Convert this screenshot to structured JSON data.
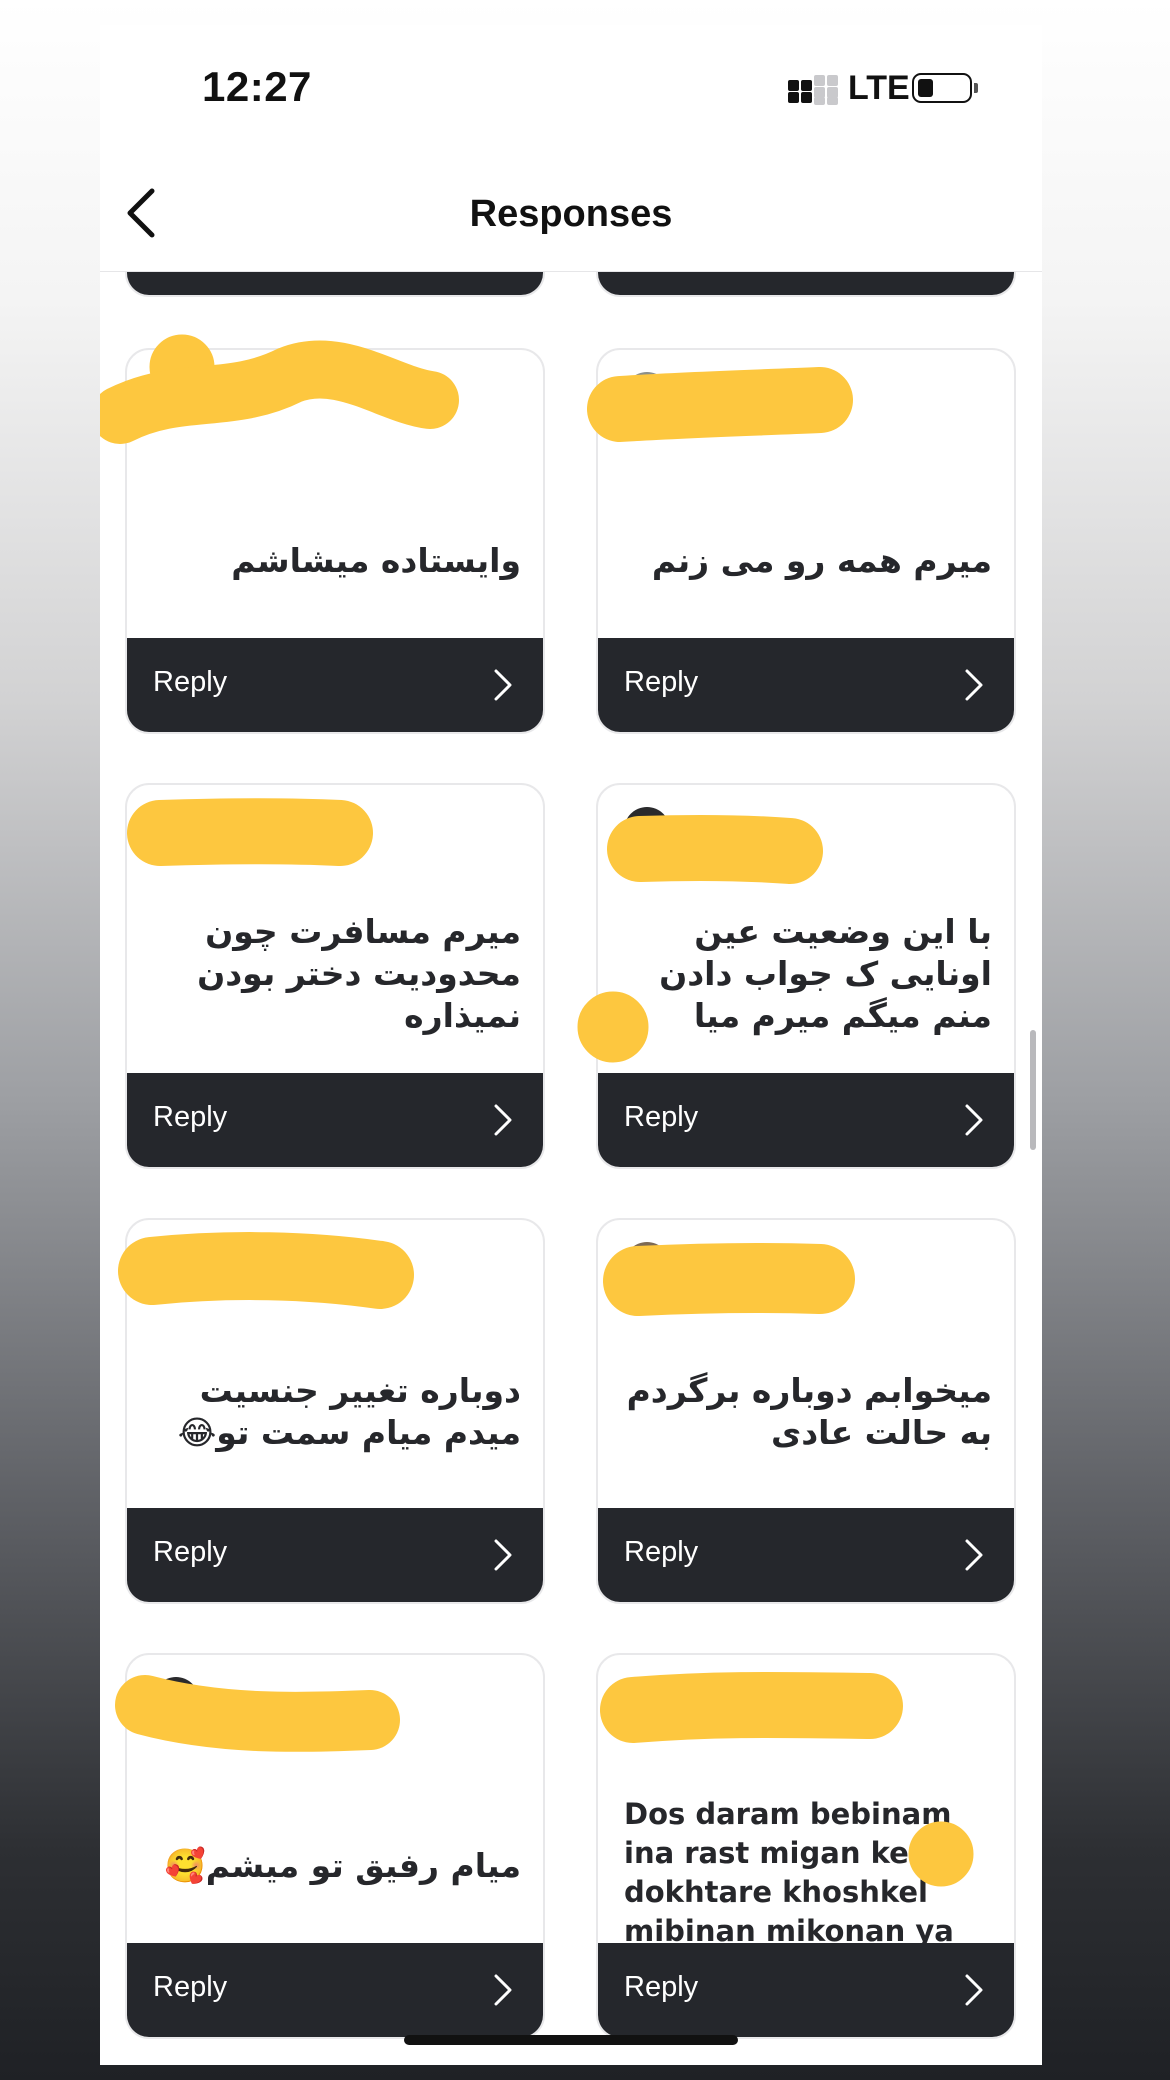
{
  "status": {
    "time": "12:27",
    "network": "LTE"
  },
  "header": {
    "title": "Responses",
    "back_icon": "chevron-left-icon"
  },
  "reply_label": "Reply",
  "cards": [
    {
      "text": "",
      "dir": "rtl"
    },
    {
      "text": "",
      "dir": "rtl"
    },
    {
      "text": "وایستاده میشاشم",
      "dir": "rtl"
    },
    {
      "text": "میرم  همه رو می زنم",
      "dir": "rtl"
    },
    {
      "text": "میرم مسافرت چون محدودیت دختر بودن نمیذاره",
      "dir": "rtl"
    },
    {
      "text": "با این وضعیت عین اونایی ک جواب دادن منم میگم میرم میا",
      "dir": "rtl"
    },
    {
      "text": "دوباره تغییر جنسیت میدم میام سمت تو😂",
      "dir": "rtl"
    },
    {
      "text": "میخوابم دوباره برگردم به حالت عادی",
      "dir": "rtl"
    },
    {
      "text": "میام رفیق تو میشم🥰",
      "dir": "rtl"
    },
    {
      "text": "Dos daram bebinam ina rast migan ke dokhtare khoshkel mibinan mikonan ya na😂",
      "dir": "ltr"
    }
  ],
  "colors": {
    "accent_dark": "#25272c",
    "redaction": "#fdc73f"
  }
}
